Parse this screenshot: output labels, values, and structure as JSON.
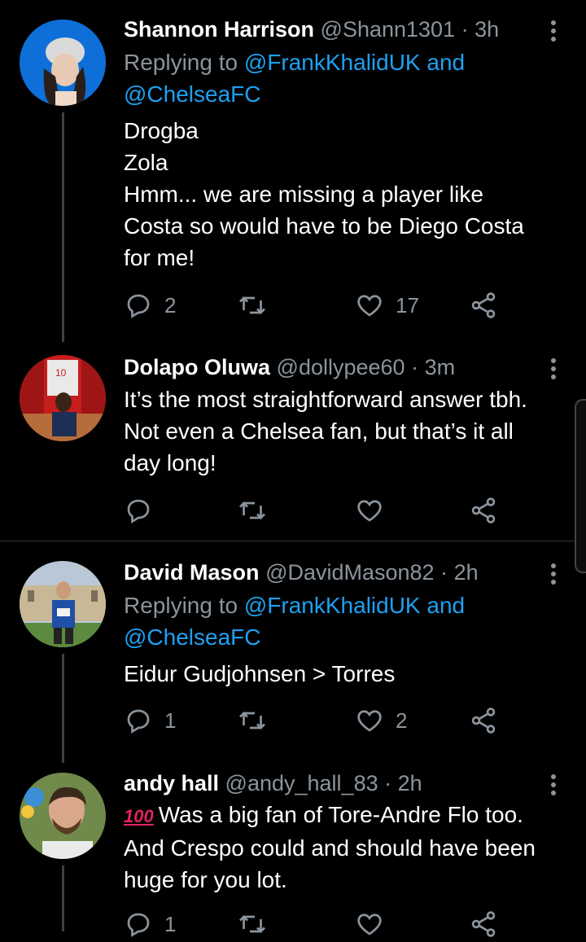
{
  "tweets": [
    {
      "name": "Shannon Harrison",
      "handle": "@Shann1301",
      "dot": "·",
      "time": "3h",
      "replying_prefix": "Replying to ",
      "mention1": "@FrankKhalidUK",
      "and": " and",
      "mention2": "@ChelseaFC",
      "lines": [
        "Drogba",
        "Zola",
        "Hmm... we are missing a player like",
        "Costa so would have to be Diego Costa",
        "for me!"
      ],
      "replies": "2",
      "retweets": "",
      "likes": "17"
    },
    {
      "name": "Dolapo Oluwa",
      "handle": "@dollypee60",
      "dot": "·",
      "time": "3m",
      "lines": [
        "It’s the most straightforward answer tbh.",
        "Not even a Chelsea fan, but that’s it all",
        "day long!"
      ],
      "replies": "",
      "retweets": "",
      "likes": ""
    },
    {
      "name": "David Mason",
      "handle": "@DavidMason82",
      "dot": "·",
      "time": "2h",
      "replying_prefix": "Replying to ",
      "mention1": "@FrankKhalidUK",
      "and": " and",
      "mention2": "@ChelseaFC",
      "lines": [
        "Eidur Gudjohnsen > Torres"
      ],
      "replies": "1",
      "retweets": "",
      "likes": "2"
    },
    {
      "name": "andy hall",
      "handle": "@andy_hall_83",
      "dot": "·",
      "time": "2h",
      "emoji": "100",
      "lines": [
        "Was a big fan of Tore-Andre Flo too.",
        "And Crespo could and should have been",
        "huge for you lot."
      ],
      "replies": "1",
      "retweets": "",
      "likes": ""
    }
  ],
  "colors": {
    "background": "#000000",
    "link": "#1da1f2",
    "muted": "#8b949c"
  }
}
